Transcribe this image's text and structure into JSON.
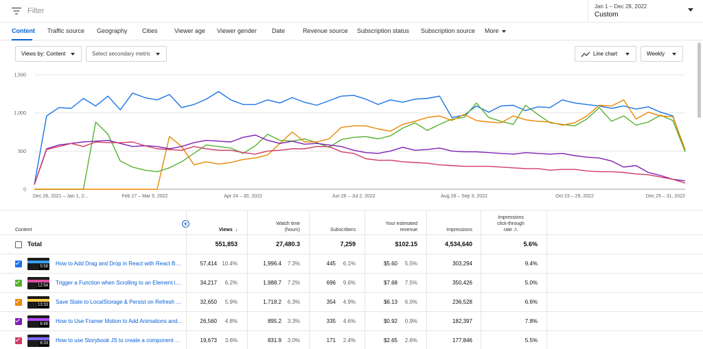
{
  "filter": {
    "placeholder": "Filter"
  },
  "date": {
    "range": "Jan 1 – Dec 28, 2022",
    "preset": "Custom"
  },
  "tabs": [
    {
      "label": "Content",
      "active": true
    },
    {
      "label": "Traffic source"
    },
    {
      "label": "Geography"
    },
    {
      "label": "Cities"
    },
    {
      "label": "Viewer age"
    },
    {
      "label": "Viewer gender"
    },
    {
      "label": "Date"
    },
    {
      "label": "Revenue source"
    },
    {
      "label": "Subscription status"
    },
    {
      "label": "Subscription source"
    },
    {
      "label": "More"
    }
  ],
  "controls": {
    "primary_metric": "Views by: Content",
    "secondary_metric": "Select secondary metric",
    "chart_type": "Line chart",
    "granularity": "Weekly"
  },
  "colors": {
    "accent": "#065fd4",
    "blue": "#1a73e8",
    "green": "#55b02e",
    "orange": "#ea8600",
    "purple": "#7e1fb4",
    "pink": "#d13a64"
  },
  "chart_data": {
    "type": "line",
    "ylim": [
      0,
      1500
    ],
    "yticks": [
      "0",
      "500",
      "1,000",
      "1,500"
    ],
    "xlabels": [
      "Dec 26, 2021 – Jan 1, 2...",
      "Feb 27 – Mar 5, 2022",
      "Apr 24 – 30, 2022",
      "Jun 26 – Jul 2, 2022",
      "Aug 28 – Sep 3, 2022",
      "Oct 23 – 29, 2022",
      "Dec 25 – 31, 2022"
    ],
    "weeks": 53,
    "series": [
      {
        "color": "#1a73e8",
        "values": [
          60,
          960,
          1070,
          1060,
          1190,
          1090,
          1220,
          1040,
          1260,
          1200,
          1170,
          1240,
          1070,
          1110,
          1180,
          1280,
          1170,
          1110,
          1110,
          1170,
          1130,
          1200,
          1140,
          1100,
          1160,
          1220,
          1230,
          1180,
          1110,
          1170,
          1140,
          1180,
          1190,
          1220,
          940,
          970,
          1090,
          1010,
          1090,
          1100,
          1030,
          1080,
          1070,
          1170,
          1130,
          1110,
          1090,
          1060,
          1090,
          1050,
          1080,
          1010,
          960,
          500
        ]
      },
      {
        "color": "#55b02e",
        "values": [
          0,
          0,
          0,
          0,
          0,
          880,
          720,
          370,
          290,
          250,
          230,
          280,
          360,
          470,
          580,
          560,
          540,
          470,
          570,
          720,
          640,
          630,
          660,
          610,
          550,
          650,
          680,
          690,
          660,
          700,
          800,
          870,
          770,
          850,
          920,
          940,
          1130,
          940,
          890,
          850,
          1100,
          980,
          870,
          850,
          830,
          920,
          1070,
          890,
          960,
          840,
          880,
          970,
          900,
          490
        ]
      },
      {
        "color": "#ea8600",
        "values": [
          0,
          0,
          0,
          0,
          0,
          0,
          0,
          0,
          0,
          0,
          0,
          690,
          560,
          320,
          360,
          330,
          350,
          390,
          410,
          450,
          600,
          750,
          620,
          620,
          660,
          810,
          830,
          830,
          790,
          760,
          850,
          890,
          940,
          960,
          900,
          980,
          900,
          880,
          870,
          960,
          910,
          890,
          880,
          840,
          870,
          960,
          1100,
          1090,
          1170,
          920,
          1010,
          960,
          950,
          520
        ]
      },
      {
        "color": "#7e1fb4",
        "values": [
          60,
          530,
          580,
          600,
          620,
          630,
          640,
          600,
          560,
          570,
          560,
          530,
          560,
          610,
          640,
          630,
          620,
          680,
          710,
          640,
          600,
          630,
          590,
          600,
          580,
          560,
          510,
          480,
          470,
          500,
          550,
          510,
          520,
          540,
          500,
          490,
          490,
          480,
          470,
          460,
          480,
          470,
          460,
          470,
          440,
          420,
          410,
          370,
          290,
          310,
          220,
          180,
          130,
          110
        ]
      },
      {
        "color": "#d13a64",
        "values": [
          60,
          520,
          560,
          600,
          560,
          620,
          610,
          610,
          620,
          570,
          530,
          520,
          510,
          560,
          530,
          510,
          510,
          480,
          460,
          500,
          510,
          530,
          530,
          560,
          560,
          490,
          470,
          400,
          380,
          380,
          360,
          350,
          340,
          320,
          310,
          300,
          300,
          300,
          290,
          280,
          270,
          270,
          250,
          260,
          260,
          240,
          230,
          230,
          220,
          200,
          190,
          160,
          130,
          80
        ]
      }
    ]
  },
  "table": {
    "headers": {
      "content": "Content",
      "views": "Views",
      "sort_icon": "↓",
      "watch_time_1": "Watch time",
      "watch_time_2": "(hours)",
      "subscribers": "Subscribers",
      "revenue_1": "Your estimated",
      "revenue_2": "revenue",
      "impressions": "Impressions",
      "ctr_1": "Impressions",
      "ctr_2": "click-through",
      "ctr_3": "rate",
      "ctr_icon": "⚠"
    },
    "total": {
      "label": "Total",
      "views": "551,853",
      "watch_time": "27,480.3",
      "subscribers": "7,259",
      "revenue": "$102.15",
      "impressions": "4,534,640",
      "ctr": "5.6%"
    },
    "rows": [
      {
        "color": "#1a73e8",
        "thumb_band": "#3aa0ff",
        "duration": "5:58",
        "title": "How to Add Drag and Drop in React with React Beautif...",
        "views": "57,414",
        "views_pct": "10.4%",
        "watch": "1,996.4",
        "watch_pct": "7.3%",
        "subs": "445",
        "subs_pct": "6.1%",
        "rev": "$5.60",
        "rev_pct": "5.5%",
        "impr": "303,294",
        "ctr": "9.4%"
      },
      {
        "color": "#55b02e",
        "thumb_band": "#e04fa0",
        "duration": "12:54",
        "title": "Trigger a Function when Scrolling to an Element in Rea...",
        "views": "34,217",
        "views_pct": "6.2%",
        "watch": "1,988.7",
        "watch_pct": "7.2%",
        "subs": "696",
        "subs_pct": "9.6%",
        "rev": "$7.68",
        "rev_pct": "7.5%",
        "impr": "350,426",
        "ctr": "5.0%"
      },
      {
        "color": "#ea8600",
        "thumb_band": "#ffd04a",
        "duration": "13:33",
        "title": "Save State to LocalStorage & Persist on Refresh with R...",
        "views": "32,650",
        "views_pct": "5.9%",
        "watch": "1,718.2",
        "watch_pct": "6.3%",
        "subs": "354",
        "subs_pct": "4.9%",
        "rev": "$6.13",
        "rev_pct": "6.0%",
        "impr": "236,528",
        "ctr": "6.6%"
      },
      {
        "color": "#7e1fb4",
        "thumb_band": "#b44cff",
        "duration": "6:49",
        "title": "How to Use Framer Motion to Add Animations and Pa...",
        "views": "26,560",
        "views_pct": "4.8%",
        "watch": "895.2",
        "watch_pct": "3.3%",
        "subs": "335",
        "subs_pct": "4.6%",
        "rev": "$0.92",
        "rev_pct": "0.9%",
        "impr": "182,397",
        "ctr": "7.8%"
      },
      {
        "color": "#d13a64",
        "thumb_band": "#7f6bff",
        "duration": "6:33",
        "title": "How to use Storybook JS to create a component desig...",
        "views": "19,673",
        "views_pct": "3.6%",
        "watch": "831.9",
        "watch_pct": "3.0%",
        "subs": "171",
        "subs_pct": "2.4%",
        "rev": "$2.65",
        "rev_pct": "2.6%",
        "impr": "177,846",
        "ctr": "5.5%"
      }
    ]
  }
}
